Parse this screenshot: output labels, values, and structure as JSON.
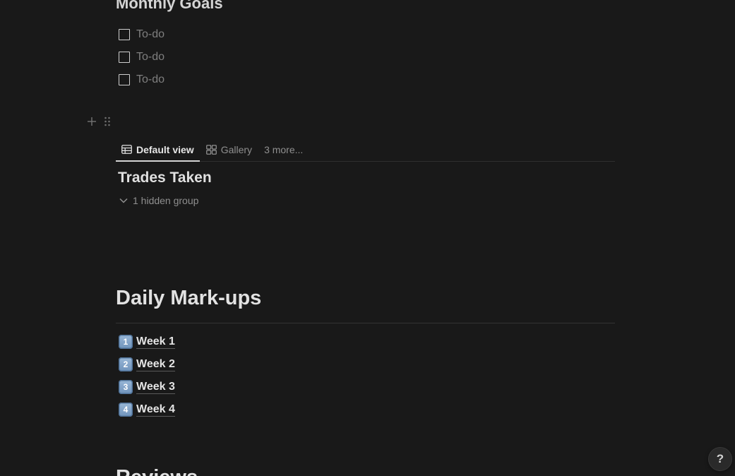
{
  "monthly_goals": {
    "title": "Monthly Goals",
    "todos": [
      {
        "label": "To-do",
        "checked": false
      },
      {
        "label": "To-do",
        "checked": false
      },
      {
        "label": "To-do",
        "checked": false
      }
    ]
  },
  "block_controls": {
    "add_icon": "plus-icon",
    "drag_icon": "drag-handle-icon"
  },
  "database": {
    "tabs": [
      {
        "label": "Default view",
        "icon": "table-icon",
        "active": true
      },
      {
        "label": "Gallery",
        "icon": "gallery-icon",
        "active": false
      },
      {
        "label": "3 more...",
        "active": false
      }
    ],
    "title": "Trades Taken",
    "hidden_group_label": "1 hidden group"
  },
  "daily_markups": {
    "title": "Daily Mark-ups",
    "weeks": [
      {
        "number": "1",
        "label": "Week 1"
      },
      {
        "number": "2",
        "label": "Week 2"
      },
      {
        "number": "3",
        "label": "Week 3"
      },
      {
        "number": "4",
        "label": "Week 4"
      }
    ]
  },
  "next_heading": "Reviews",
  "help": {
    "label": "?"
  },
  "colors": {
    "background": "#191919",
    "text": "#d4d4d4",
    "muted": "#8f8f8f",
    "keycap": "#7fa2c8"
  }
}
